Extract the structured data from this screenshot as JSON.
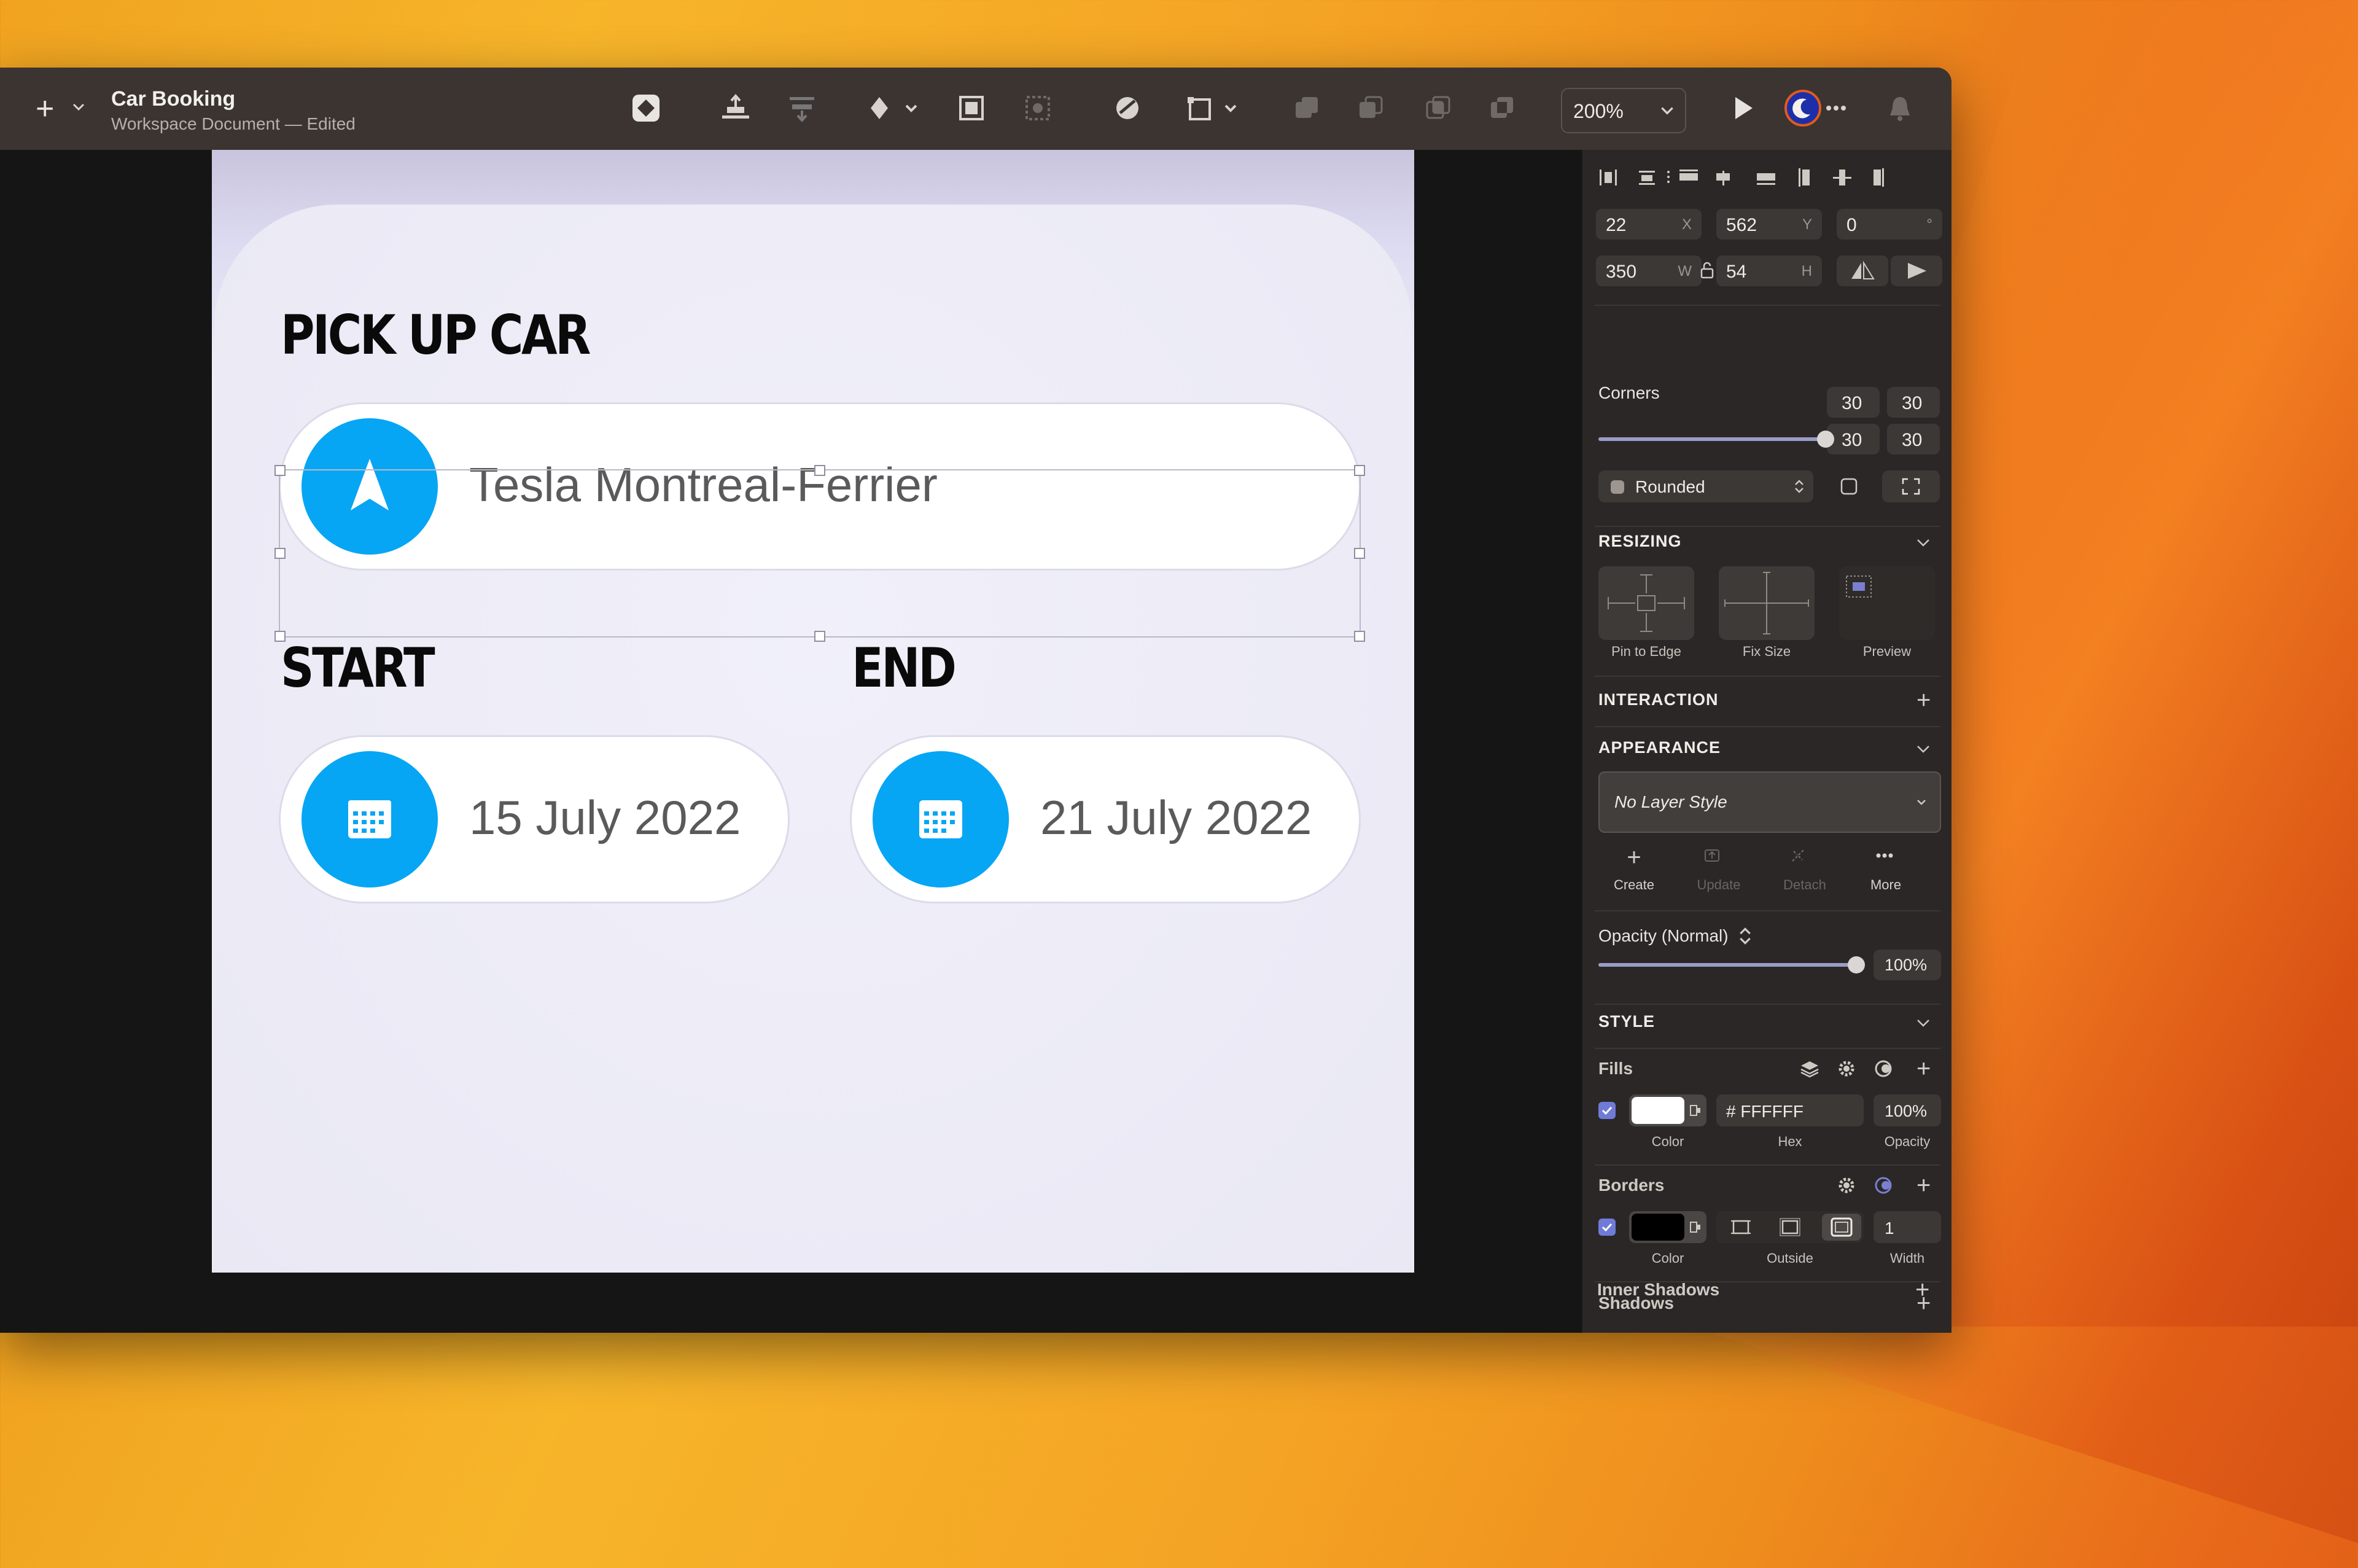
{
  "document": {
    "title": "Car Booking",
    "subtitle": "Workspace Document — Edited"
  },
  "toolbar": {
    "zoom": "200%"
  },
  "artboard": {
    "pickup_heading": "PICK UP CAR",
    "pickup_location": "Tesla Montreal-Ferrier",
    "start_heading": "START",
    "start_date": "15 July 2022",
    "end_heading": "END",
    "end_date": "21 July 2022",
    "accent_color": "#06a6f4"
  },
  "inspector": {
    "position": {
      "x": "22",
      "x_unit": "X",
      "y": "562",
      "y_unit": "Y",
      "rotation": "0",
      "rotation_unit": "°"
    },
    "size": {
      "w": "350",
      "w_unit": "W",
      "h": "54",
      "h_unit": "H"
    },
    "corners": {
      "label": "Corners",
      "tl": "30",
      "tr": "30",
      "bl": "30",
      "br": "30",
      "slider_fraction": 1.0,
      "style": "Rounded"
    },
    "resizing": {
      "title": "RESIZING",
      "options": [
        "Pin to Edge",
        "Fix Size",
        "Preview"
      ]
    },
    "interaction": {
      "title": "INTERACTION"
    },
    "appearance": {
      "title": "APPEARANCE",
      "layer_style": "No Layer Style",
      "actions": [
        "Create",
        "Update",
        "Detach",
        "More"
      ],
      "opacity_label": "Opacity (Normal)",
      "opacity_value": "100%",
      "opacity_fraction": 1.0
    },
    "style": {
      "title": "STYLE",
      "fills_label": "Fills",
      "fill_hex": "# FFFFFF",
      "fill_opacity": "100%",
      "fill_color": "#FFFFFF",
      "fill_captions": [
        "Color",
        "Hex",
        "Opacity"
      ],
      "borders_label": "Borders",
      "border_color": "#000000",
      "border_width": "1",
      "border_captions": [
        "Color",
        "Outside",
        "Width"
      ],
      "shadows_label": "Shadows",
      "inner_shadows_label": "Inner Shadows"
    }
  }
}
